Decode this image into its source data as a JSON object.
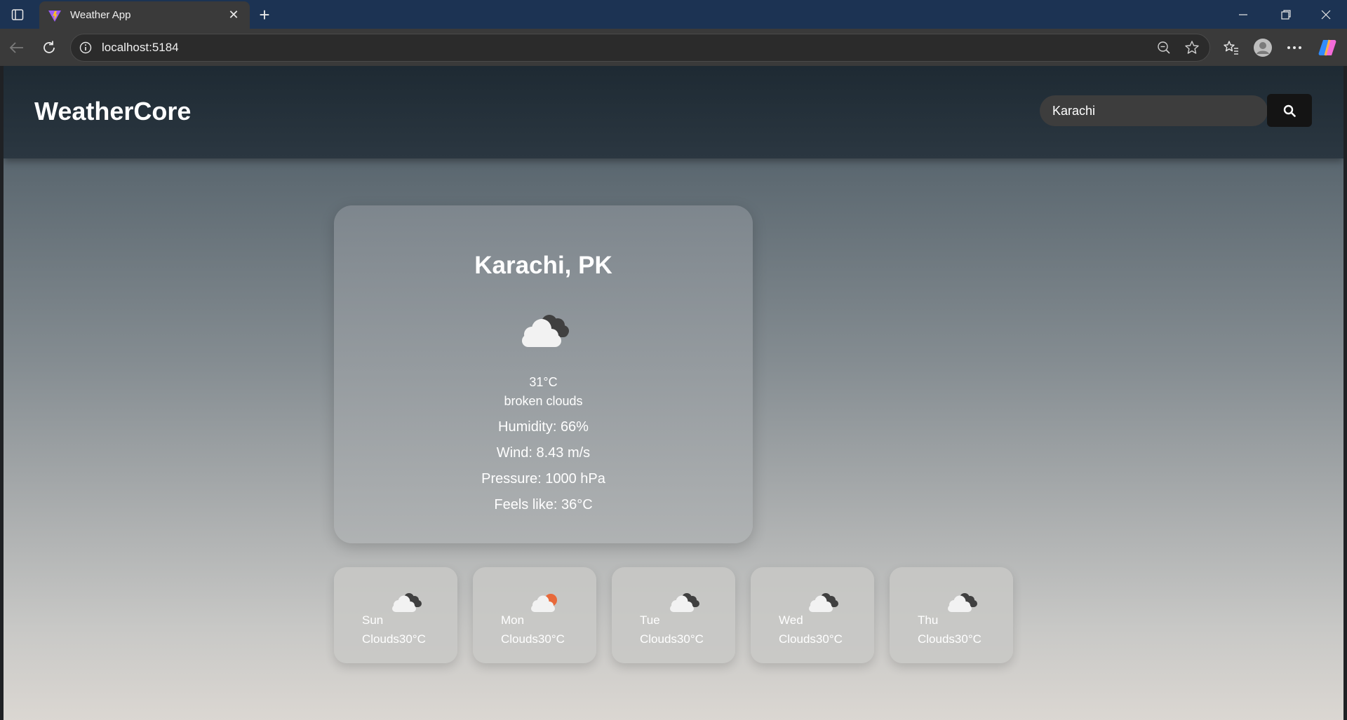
{
  "browser": {
    "tab_title": "Weather App",
    "url": "localhost:5184"
  },
  "app": {
    "brand": "WeatherCore",
    "search": {
      "value": "Karachi"
    }
  },
  "current": {
    "city": "Karachi, PK",
    "icon": "broken-clouds-icon",
    "temperature": "31°C",
    "description": "broken clouds",
    "humidity": "Humidity: 66%",
    "wind": "Wind: 8.43 m/s",
    "pressure": "Pressure: 1000 hPa",
    "feels_like": "Feels like: 36°C"
  },
  "forecast": [
    {
      "day": "Sun",
      "condition": "Clouds",
      "temp": "30°C",
      "icon": "broken-clouds-icon"
    },
    {
      "day": "Mon",
      "condition": "Clouds",
      "temp": "30°C",
      "icon": "sun-behind-cloud-icon"
    },
    {
      "day": "Tue",
      "condition": "Clouds",
      "temp": "30°C",
      "icon": "broken-clouds-icon"
    },
    {
      "day": "Wed",
      "condition": "Clouds",
      "temp": "30°C",
      "icon": "broken-clouds-icon"
    },
    {
      "day": "Thu",
      "condition": "Clouds",
      "temp": "30°C",
      "icon": "broken-clouds-icon"
    }
  ],
  "colors": {
    "tabbar": "#1c3353",
    "header": "#1e2a33",
    "search_button": "#141414",
    "sun": "#e8693a"
  }
}
